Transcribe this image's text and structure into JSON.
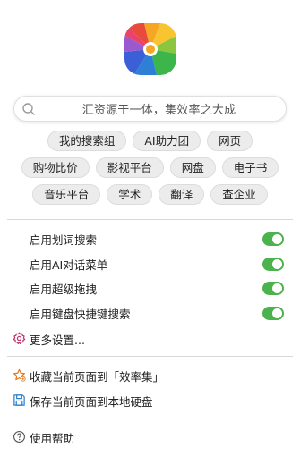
{
  "search": {
    "placeholder": "汇资源于一体，集效率之大成"
  },
  "tags": [
    [
      "我的搜索组",
      "AI助力团",
      "网页"
    ],
    [
      "购物比价",
      "影视平台",
      "网盘",
      "电子书"
    ],
    [
      "音乐平台",
      "学术",
      "翻译",
      "查企业"
    ]
  ],
  "toggles": [
    {
      "label": "启用划词搜索",
      "on": true
    },
    {
      "label": "启用AI对话菜单",
      "on": true
    },
    {
      "label": "启用超级拖拽",
      "on": true
    },
    {
      "label": "启用键盘快捷键搜索",
      "on": true
    }
  ],
  "menu": {
    "more_settings": "更多设置...",
    "bookmark": "收藏当前页面到「效率集」",
    "save_local": "保存当前页面到本地硬盘",
    "help": "使用帮助"
  },
  "colors": {
    "accent_green": "#4cb24d",
    "settings_icon": "#c0306b",
    "bookmark_icon": "#e07a1f",
    "save_icon": "#2a7fc9"
  },
  "icons": {
    "logo": "app-logo",
    "search": "search-icon",
    "settings": "gear-icon",
    "bookmark": "star-icon",
    "save": "save-icon",
    "help": "help-icon"
  }
}
